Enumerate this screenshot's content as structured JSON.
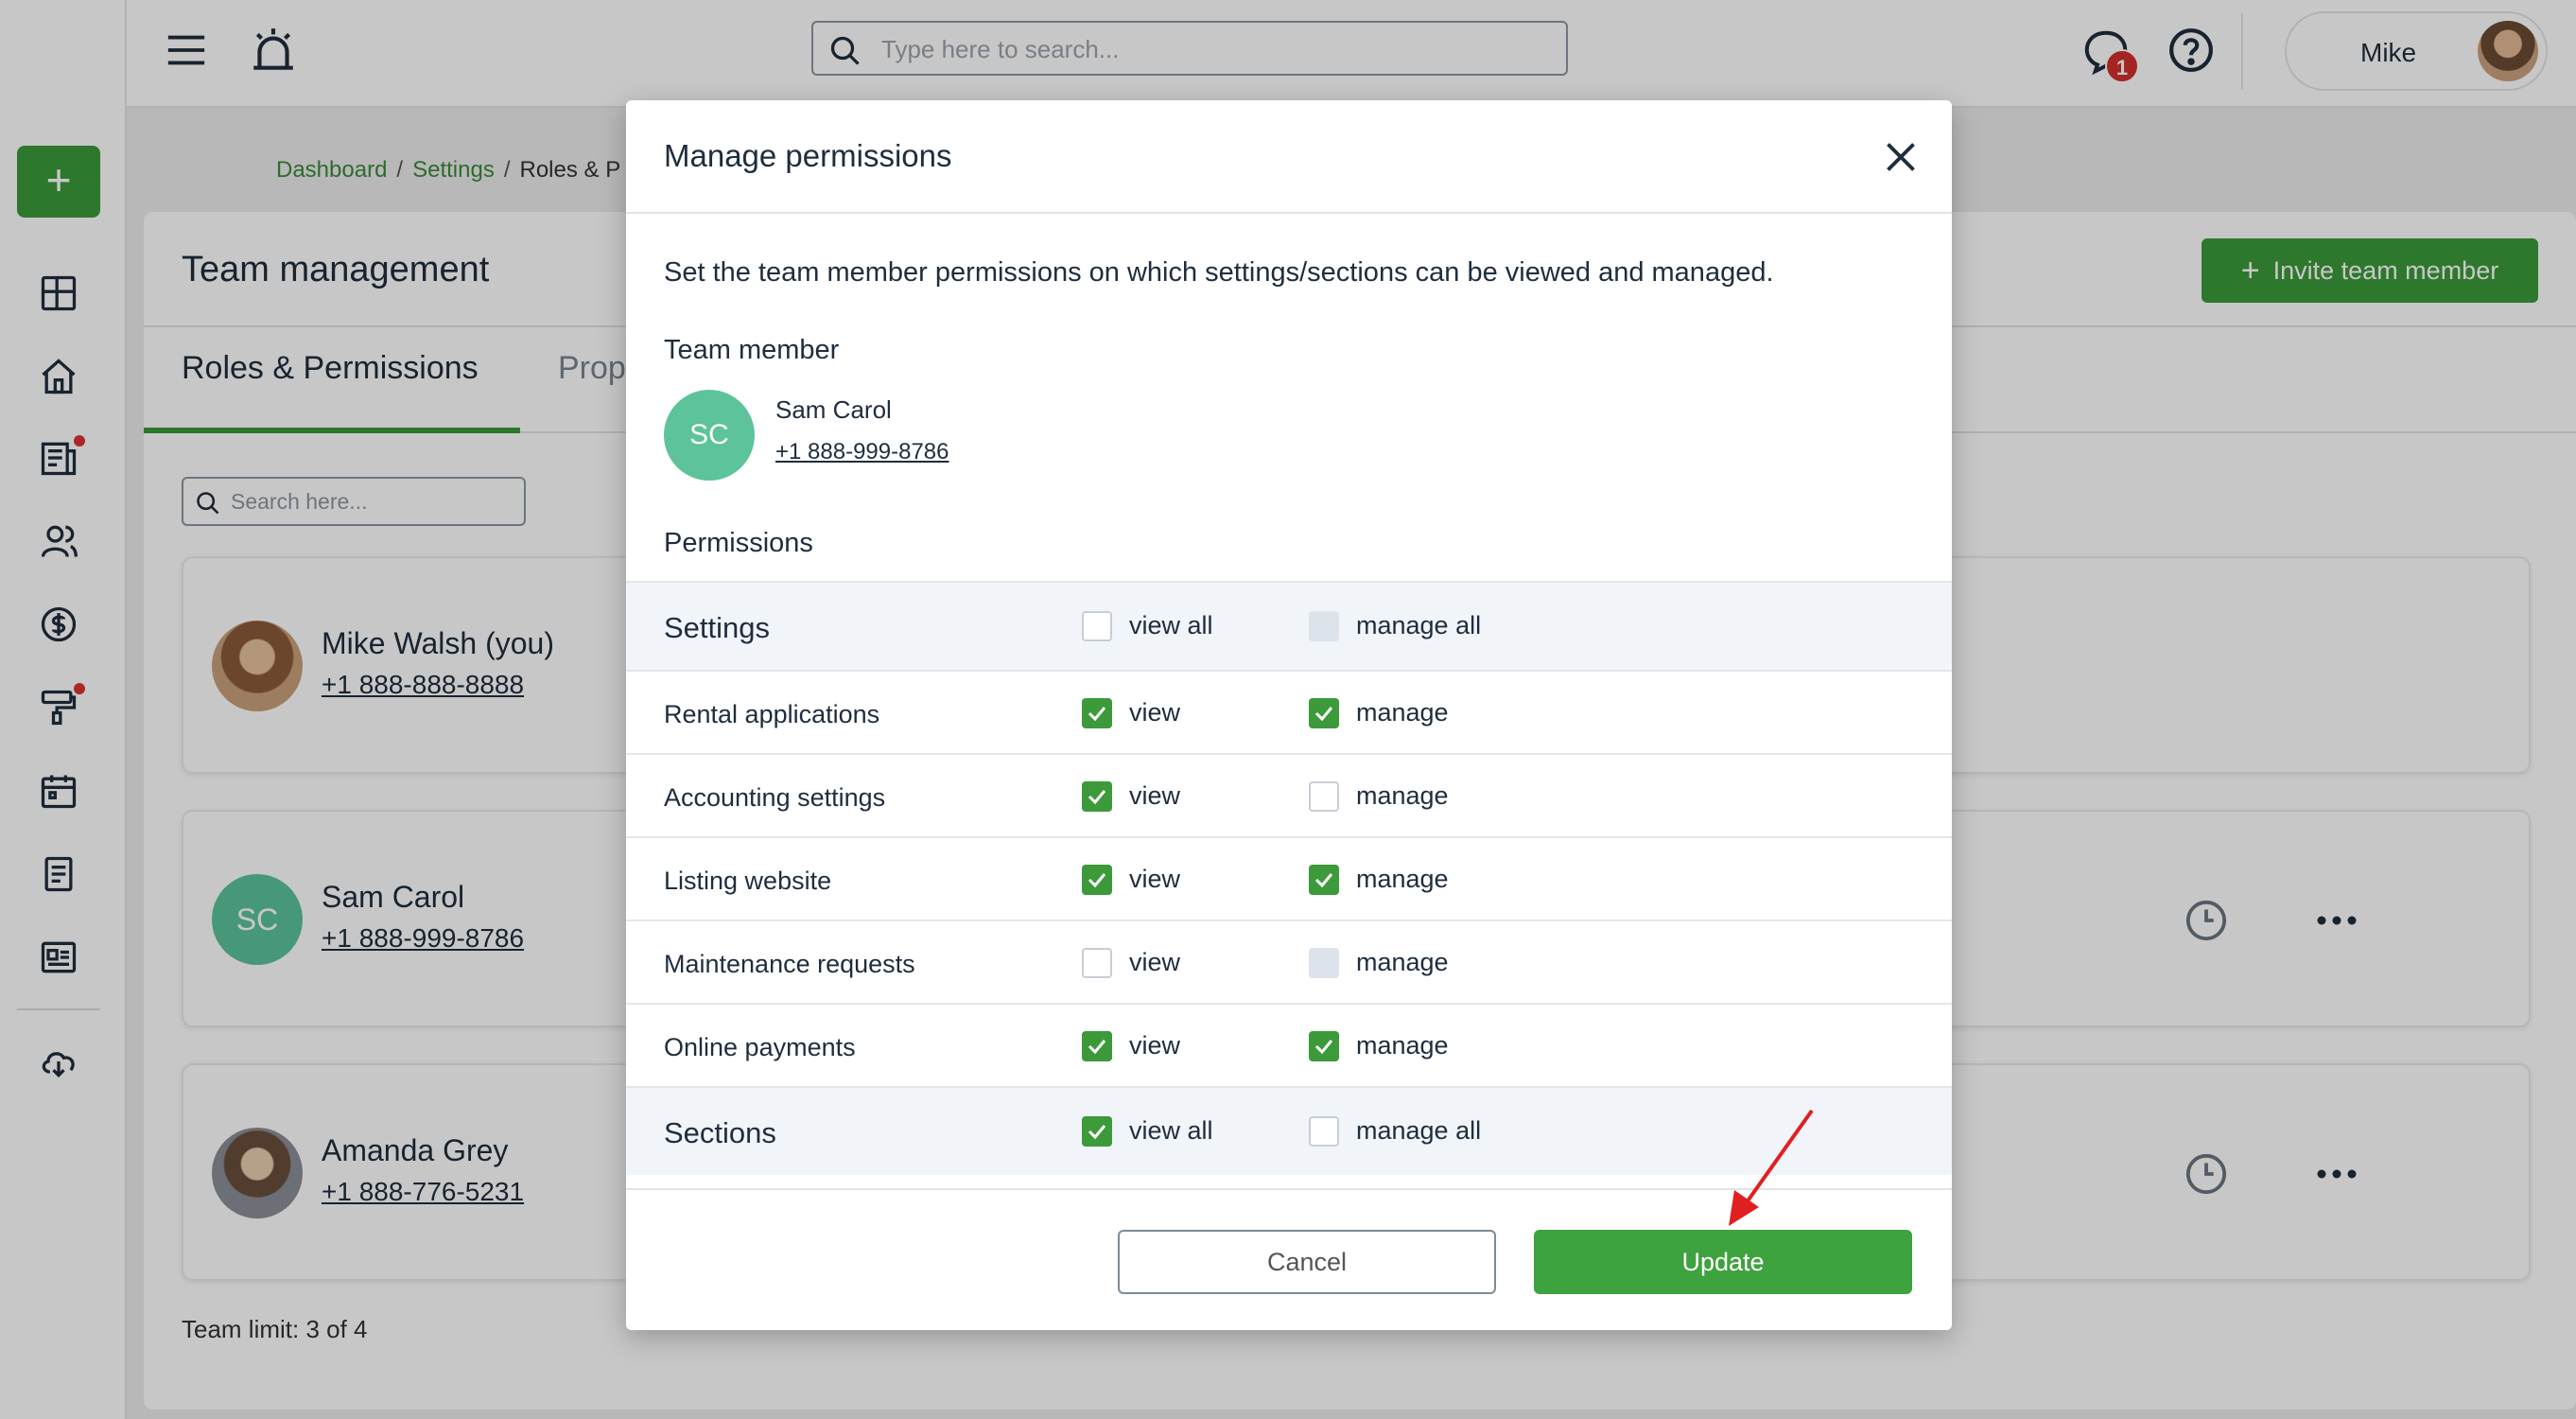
{
  "topbar": {
    "search_placeholder": "Type here to search...",
    "notification_count": "1",
    "user_name": "Mike"
  },
  "breadcrumb": {
    "items": [
      "Dashboard",
      "Settings",
      "Roles & P"
    ]
  },
  "page": {
    "title": "Team management",
    "invite_label": "Invite team member",
    "tabs": [
      "Roles & Permissions",
      "Prop"
    ],
    "search_placeholder": "Search here...",
    "members": [
      {
        "name": "Mike Walsh (you)",
        "phone": "+1 888-888-8888",
        "initials": ""
      },
      {
        "name": "Sam Carol",
        "phone": "+1 888-999-8786",
        "initials": "SC"
      },
      {
        "name": "Amanda Grey",
        "phone": "+1 888-776-5231",
        "initials": ""
      }
    ],
    "team_limit": "Team limit: 3 of 4"
  },
  "modal": {
    "title": "Manage permissions",
    "description": "Set the team member permissions on which settings/sections can be viewed and managed.",
    "team_member_label": "Team member",
    "member": {
      "initials": "SC",
      "name": "Sam Carol",
      "phone": "+1 888-999-8786"
    },
    "permissions_label": "Permissions",
    "rows": [
      {
        "label": "Settings",
        "group": true,
        "view_label": "view all",
        "manage_label": "manage all",
        "view": "off",
        "manage": "disabled"
      },
      {
        "label": "Rental applications",
        "group": false,
        "view_label": "view",
        "manage_label": "manage",
        "view": "on",
        "manage": "on"
      },
      {
        "label": "Accounting settings",
        "group": false,
        "view_label": "view",
        "manage_label": "manage",
        "view": "on",
        "manage": "off"
      },
      {
        "label": "Listing website",
        "group": false,
        "view_label": "view",
        "manage_label": "manage",
        "view": "on",
        "manage": "on"
      },
      {
        "label": "Maintenance requests",
        "group": false,
        "view_label": "view",
        "manage_label": "manage",
        "view": "off",
        "manage": "disabled"
      },
      {
        "label": "Online payments",
        "group": false,
        "view_label": "view",
        "manage_label": "manage",
        "view": "on",
        "manage": "on"
      },
      {
        "label": "Sections",
        "group": true,
        "view_label": "view all",
        "manage_label": "manage all",
        "view": "on",
        "manage": "off"
      }
    ],
    "cancel_label": "Cancel",
    "update_label": "Update"
  },
  "colors": {
    "accent": "#3c9a3a",
    "badge": "#d32f2f",
    "avatar_initials_bg": "#5cc39a",
    "annotation_arrow": "#e02020"
  },
  "icons": [
    "menu-icon",
    "alarm-icon",
    "search-icon",
    "chat-icon",
    "help-icon",
    "close-icon",
    "check-icon",
    "clock-icon",
    "more-icon",
    "plus-icon"
  ]
}
